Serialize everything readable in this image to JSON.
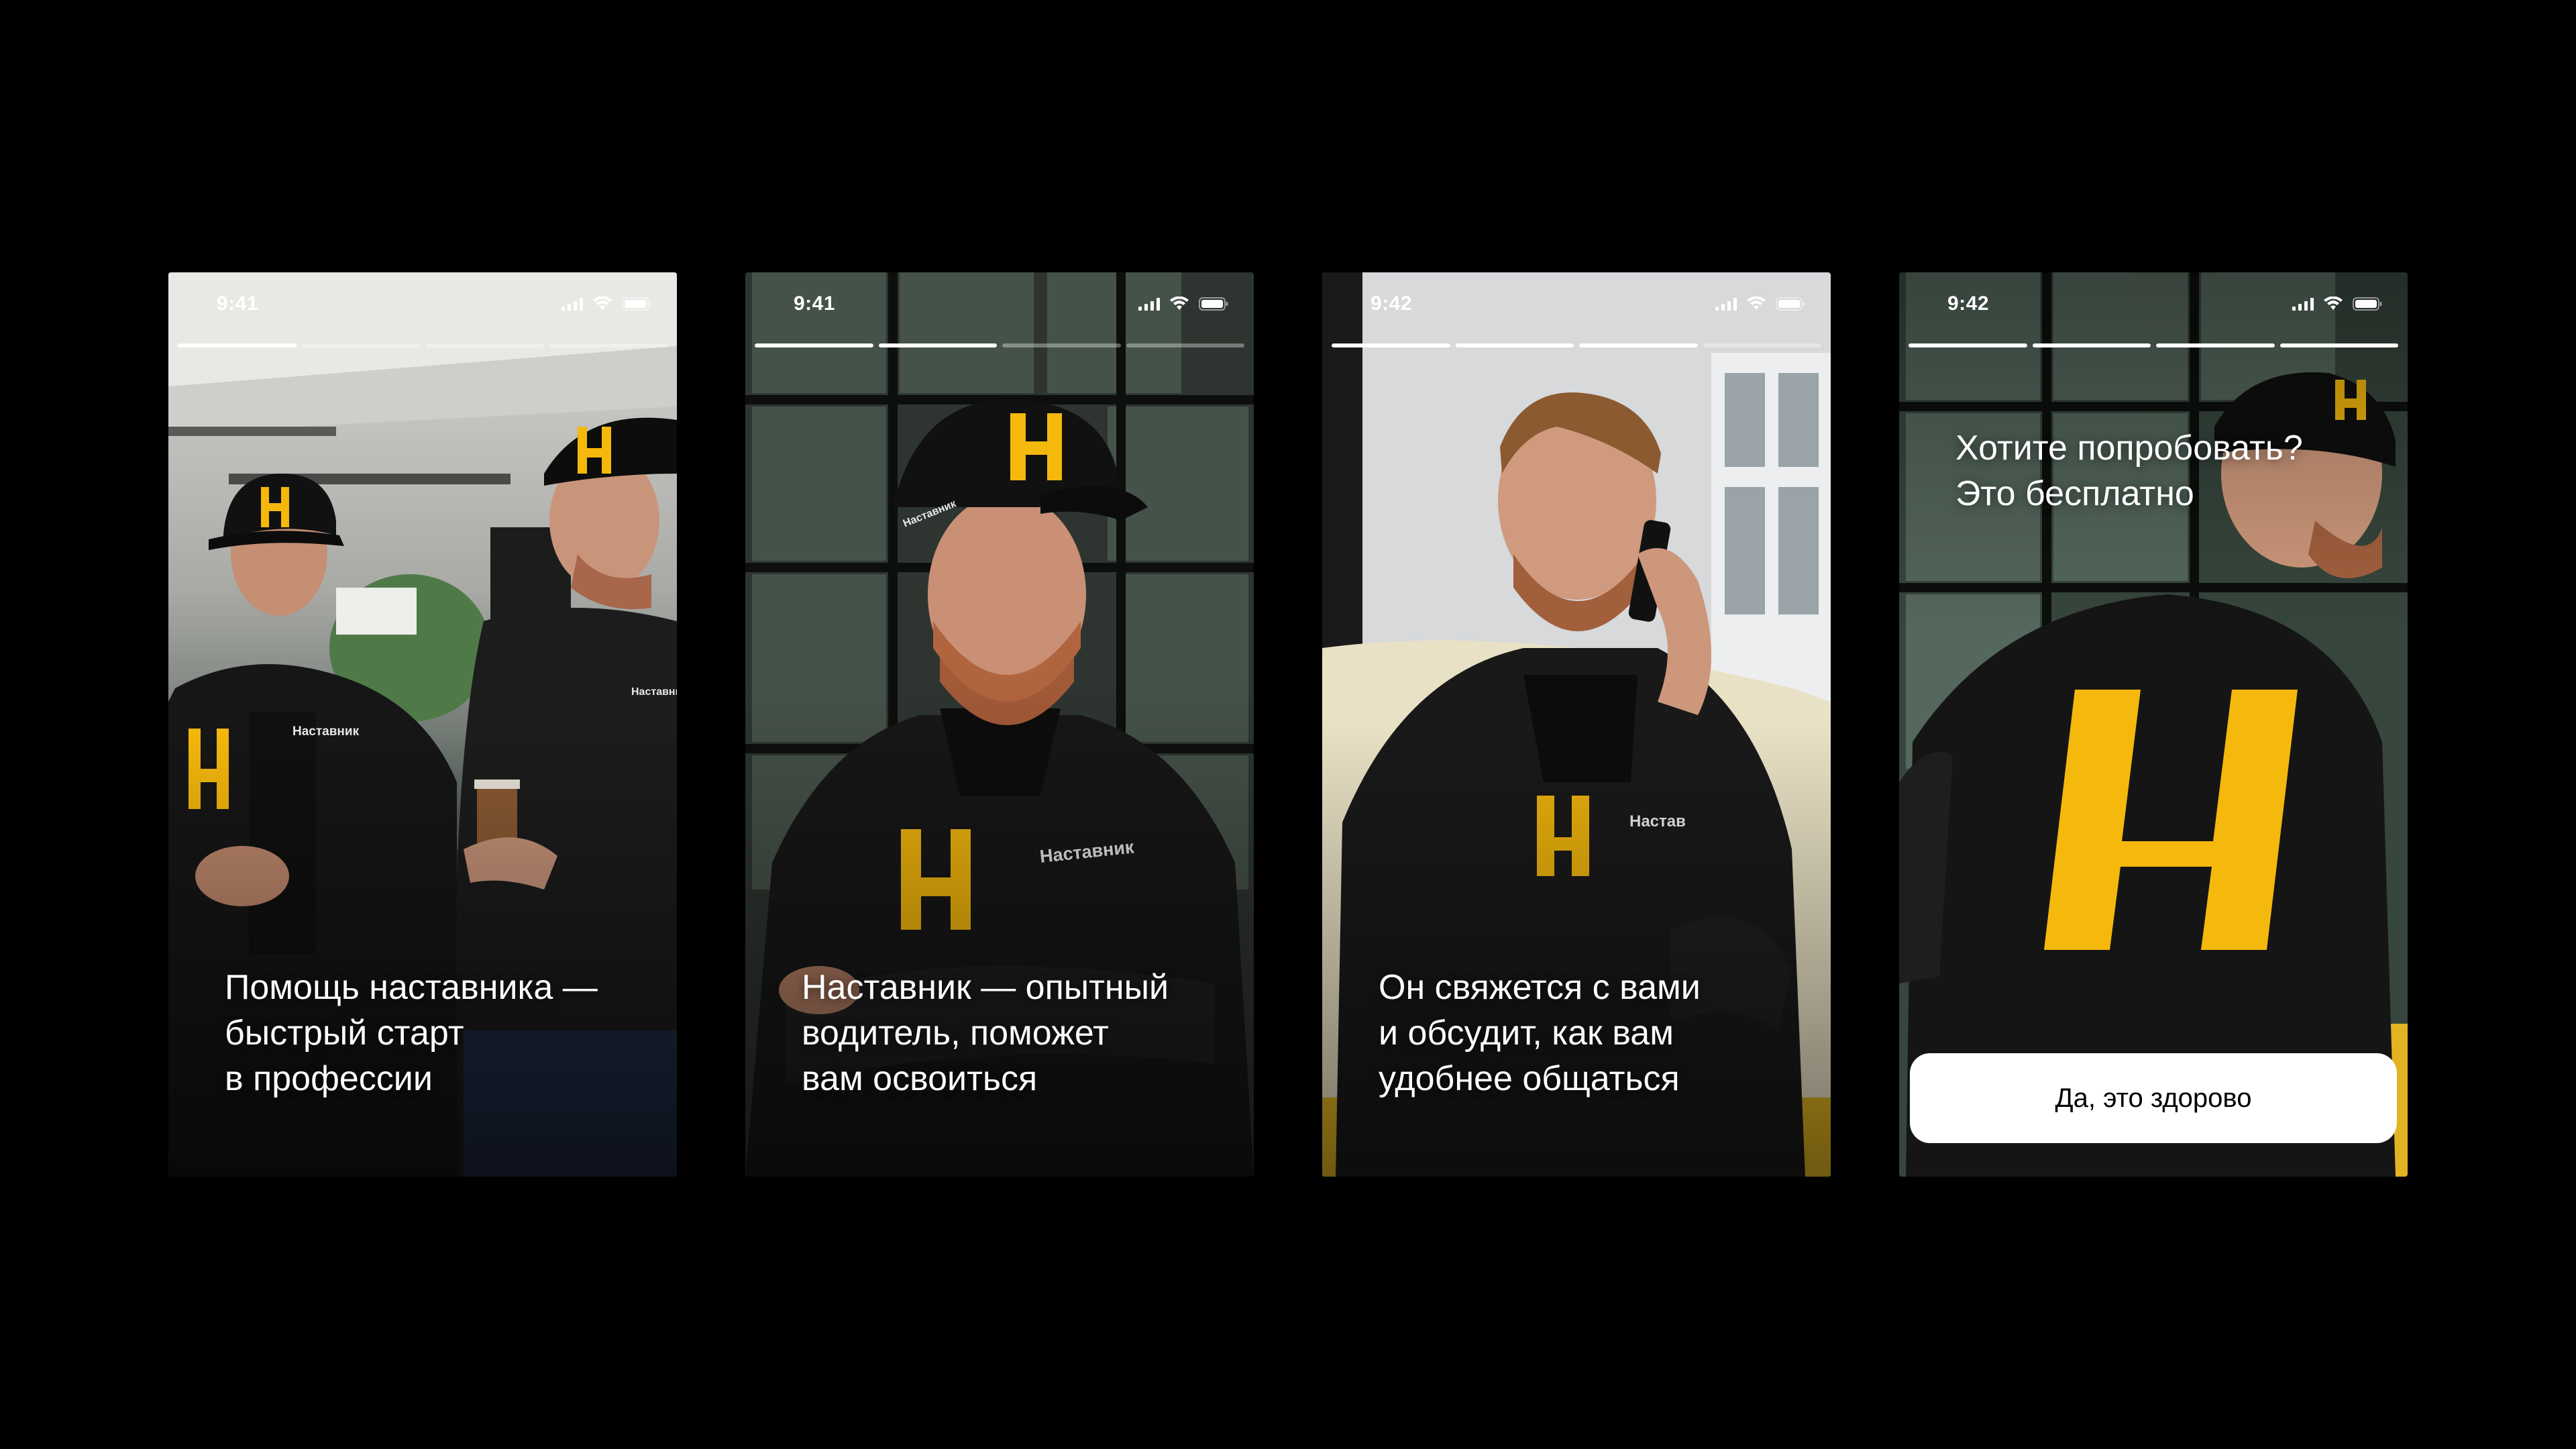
{
  "colors": {
    "background": "#000000",
    "accent_yellow": "#F5B80C",
    "jacket": "#1A1A1A",
    "text": "#FFFFFF",
    "button_bg": "#FFFFFF",
    "button_text": "#000000"
  },
  "screens": [
    {
      "time": "9:41",
      "progress": [
        1,
        0,
        0,
        0
      ],
      "caption": "Помощь наставника —\nбыстрый старт\nв профессии",
      "cap_logo": "Н",
      "jacket_text": "Наставник"
    },
    {
      "time": "9:41",
      "progress": [
        1,
        1,
        0,
        0
      ],
      "caption": "Наставник — опытный\nводитель, поможет\nвам освоиться",
      "cap_logo": "Н",
      "jacket_text": "Наставник"
    },
    {
      "time": "9:42",
      "progress": [
        1,
        1,
        1,
        0
      ],
      "caption": "Он свяжется с вами\nи обсудит, как вам\nудобнее общаться",
      "jacket_text": "Настав"
    },
    {
      "time": "9:42",
      "progress": [
        1,
        1,
        1,
        1
      ],
      "caption": "Хотите попробовать?\nЭто бесплатно",
      "button_label": "Да, это здорово",
      "cap_logo": "Н"
    }
  ],
  "icons": [
    "signal-icon",
    "wifi-icon",
    "battery-icon",
    "nastavnik-logo-icon"
  ]
}
